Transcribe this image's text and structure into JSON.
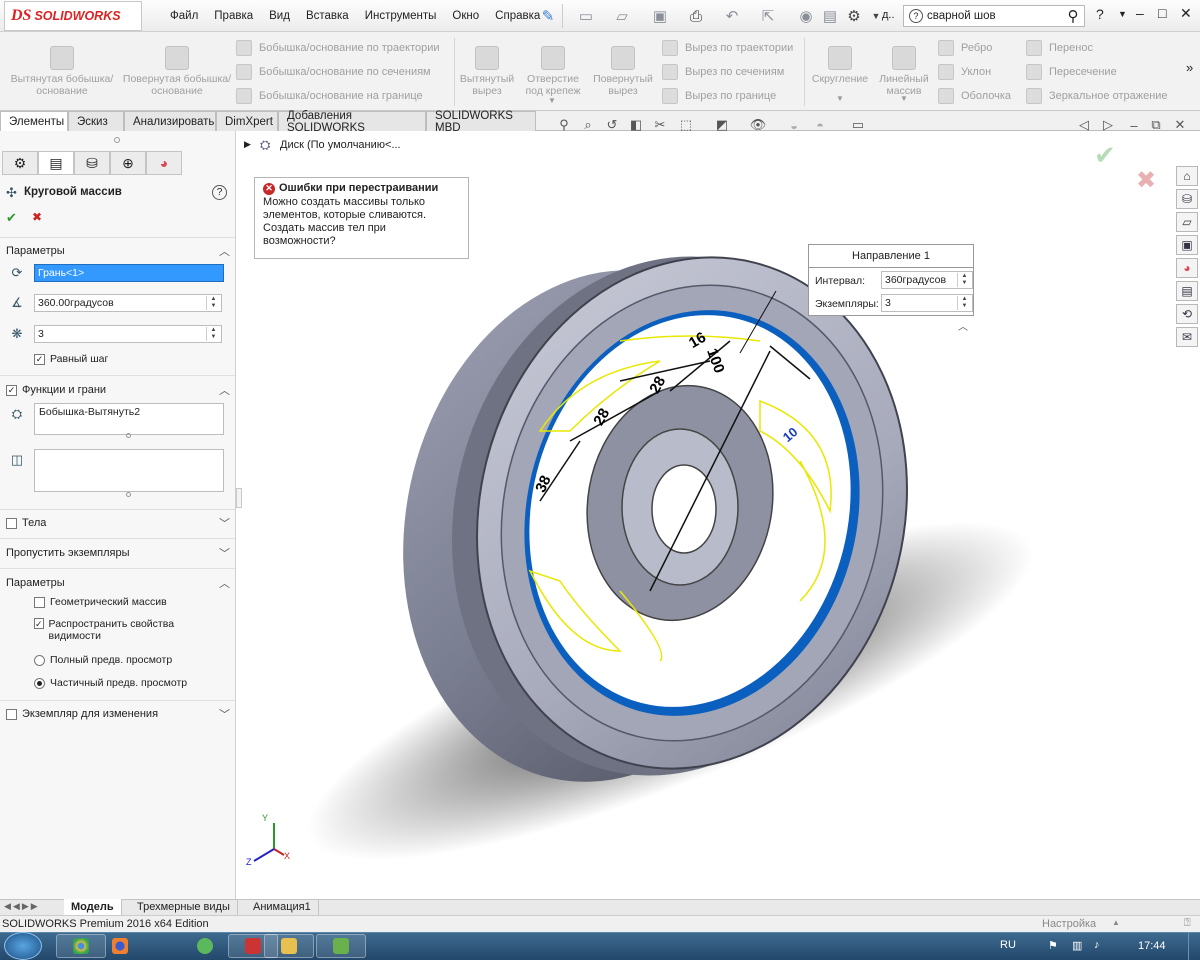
{
  "app": {
    "logo_ds": "DS",
    "logo_text": "SOLIDWORKS"
  },
  "menu": [
    "Файл",
    "Правка",
    "Вид",
    "Вставка",
    "Инструменты",
    "Окно",
    "Справка"
  ],
  "search": {
    "value": "сварной шов",
    "prefix": "д.."
  },
  "window_controls": {
    "help": "?",
    "min": "–",
    "max": "□",
    "close": "✕"
  },
  "ribbon": {
    "big": [
      {
        "label": "Вытянутая бобышка/основание"
      },
      {
        "label": "Повернутая бобышка/основание"
      },
      {
        "label": "Вытянутый вырез"
      },
      {
        "label": "Отверстие под крепеж"
      },
      {
        "label": "Повернутый вырез"
      },
      {
        "label": "Скругление"
      },
      {
        "label": "Линейный массив"
      }
    ],
    "small_col1": [
      "Бобышка/основание по траектории",
      "Бобышка/основание по сечениям",
      "Бобышка/основание на границе"
    ],
    "small_col2": [
      "Вырез по траектории",
      "Вырез по сечениям",
      "Вырез по границе"
    ],
    "small_col3": [
      "Ребро",
      "Уклон",
      "Оболочка"
    ],
    "small_col4": [
      "Перенос",
      "Пересечение",
      "Зеркальное отражение"
    ],
    "more": "»"
  },
  "tabs": [
    "Элементы",
    "Эскиз",
    "Анализировать",
    "DimXpert",
    "Добавления SOLIDWORKS",
    "SOLIDWORKS MBD"
  ],
  "tree": {
    "item": "Диск  (По умолчанию<..."
  },
  "pm": {
    "title": "Круговой массив",
    "ok": "✔",
    "cancel": "✖",
    "help": "?",
    "params_header": "Параметры",
    "axis_value": "Грань<1>",
    "angle_value": "360.00градусов",
    "count_value": "3",
    "equal_spacing": "Равный шаг",
    "features_header": "Функции и грани",
    "feature_item": "Бобышка-Вытянуть2",
    "bodies_header": "Тела",
    "skip_header": "Пропустить экземпляры",
    "options_header": "Параметры",
    "geom_pattern": "Геометрический массив",
    "propagate": "Распространить свойства видимости",
    "full_preview": "Полный предв. просмотр",
    "partial_preview": "Частичный предв. просмотр",
    "instances_header": "Экземпляр для изменения"
  },
  "error": {
    "title": "Ошибки при перестраивании",
    "body": "Можно создать массивы только элементов, которые сливаются. Создать массив тел при возможности?"
  },
  "direction": {
    "title": "Направление 1",
    "interval_label": "Интервал:",
    "interval_value": "360градусов",
    "count_label": "Экземпляры:",
    "count_value": "3"
  },
  "dims": [
    "38",
    "28",
    "28",
    "16",
    "100",
    "10"
  ],
  "triad": {
    "x": "X",
    "y": "Y",
    "z": "Z"
  },
  "bottom_tabs": [
    "Модель",
    "Трехмерные виды",
    "Анимация1"
  ],
  "status": {
    "left": "SOLIDWORKS Premium 2016 x64 Edition",
    "right": "Настройка",
    "caret": "▲"
  },
  "taskbar": {
    "lang": "RU",
    "time": "17:44"
  },
  "colors": {
    "accent_red": "#d22",
    "selection_blue": "#0b5fbf",
    "sketch_yellow": "#e8e800"
  }
}
